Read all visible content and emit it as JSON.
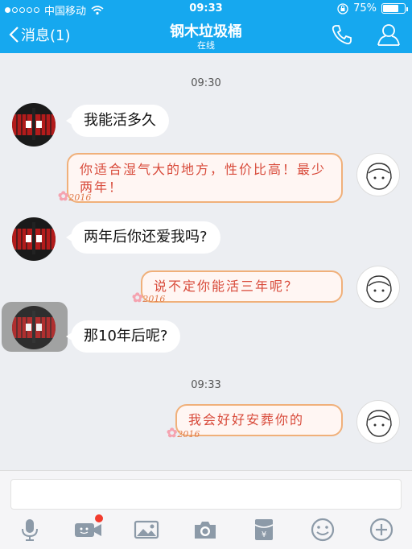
{
  "status_bar": {
    "carrier": "中国移动",
    "time": "09:33",
    "battery": "75%",
    "battery_level": 0.75,
    "signal_icon": "signal-dots-icon",
    "wifi_icon": "wifi-icon",
    "lock_icon": "orientation-lock-icon"
  },
  "header": {
    "back_label": "消息(1)",
    "title": "钢木垃圾桶",
    "subtitle": "在线",
    "call_icon": "phone-icon",
    "profile_icon": "user-profile-icon"
  },
  "chat": {
    "timestamps": [
      "09:30",
      "09:33"
    ],
    "messages": [
      {
        "side": "in",
        "text": "我能活多久"
      },
      {
        "side": "out",
        "text": "你适合湿气大的地方，性价比高！最少两年！"
      },
      {
        "side": "in",
        "text": "两年后你还爱我吗?"
      },
      {
        "side": "out",
        "text": "说不定你能活三年呢？"
      },
      {
        "side": "in",
        "text": "那10年后呢?"
      },
      {
        "side": "out",
        "text": "我会好好安葬你的"
      }
    ],
    "bubble_decoration": "2016"
  },
  "toolbar": {
    "icons": [
      "microphone-icon",
      "video-call-icon",
      "image-icon",
      "camera-icon",
      "red-packet-icon",
      "emoji-icon",
      "plus-icon"
    ]
  },
  "colors": {
    "header_bg": "#16a8ef",
    "out_text": "#d84a3a",
    "out_border": "#f0b07a",
    "badge_red": "#f23c2e"
  }
}
